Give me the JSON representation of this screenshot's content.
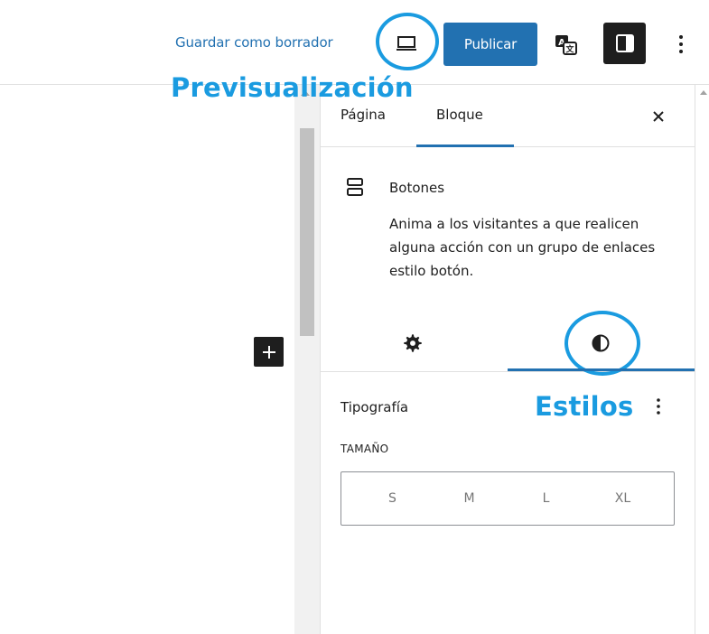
{
  "toolbar": {
    "save_draft_label": "Guardar como borrador",
    "preview_icon": "desktop-preview-icon",
    "publish_label": "Publicar",
    "translate_icon": "translate-icon",
    "settings_icon": "sidebar-toggle-icon",
    "more_icon": "more-vertical-icon"
  },
  "annotations": {
    "preview": "Previsualización",
    "styles": "Estilos",
    "highlight_color": "#1a9be0"
  },
  "canvas": {
    "add_block_icon": "plus-icon"
  },
  "sidebar": {
    "tabs": [
      {
        "label": "Página",
        "active": false
      },
      {
        "label": "Bloque",
        "active": true
      }
    ],
    "close_icon": "close-icon",
    "block": {
      "icon": "buttons-block-icon",
      "title": "Botones",
      "description": "Anima a los visitantes a que realicen alguna acción con un grupo de enlaces estilo botón."
    },
    "sub_tabs": [
      {
        "icon": "gear-icon",
        "active": false
      },
      {
        "icon": "contrast-icon",
        "active": true
      }
    ],
    "typography": {
      "title": "Tipografía",
      "menu_icon": "more-vertical-icon",
      "size_label": "TAMAÑO",
      "size_options": [
        "S",
        "M",
        "L",
        "XL"
      ]
    }
  },
  "colors": {
    "accent": "#2271b1",
    "dark": "#1e1e1e",
    "border": "#e0e0e0"
  }
}
